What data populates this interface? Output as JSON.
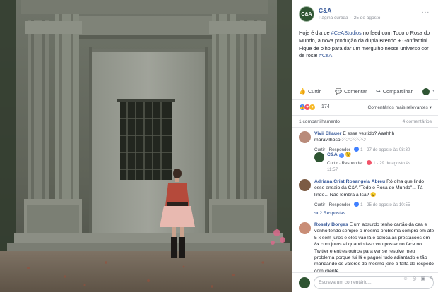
{
  "post": {
    "page_name": "C&A",
    "avatar_text": "C&A",
    "subtitle_type": "Página curtida",
    "date": "25 de agosto",
    "more_glyph": "···",
    "caption_before": "Hoje é dia de ",
    "caption_tag1": "#CeAStudios",
    "caption_middle": " no feed com Todo o Rosa do Mundo, a nova produção da dupla Brendo + Gonfiantini. Fique de olho para dar um mergulho nesse universo cor de rosa! ",
    "caption_tag2": "#CeA"
  },
  "actions": {
    "like": "Curtir",
    "comment": "Comentar",
    "share": "Compartilhar",
    "like_icon": "thumbs-up-icon",
    "comment_icon": "speech-bubble-icon",
    "share_icon": "share-arrow-icon"
  },
  "reactions": {
    "count": "174",
    "relevance": "Comentários mais relevantes ▾",
    "types": [
      "like",
      "love",
      "wow"
    ]
  },
  "shares": {
    "shares_text": "1 compartilhamento",
    "comments_text": "4 comentários"
  },
  "comments": [
    {
      "name": "Vivii Ellauer",
      "text": " E esse vestido? Aaahhh maravilhoso♡♡♡♡♡♡",
      "meta_actions": "Curtir · Responder ·",
      "meta_count": " 1",
      "meta_date": " · 27 de agosto às 08:30"
    },
    {
      "name": "C&A",
      "text": " ",
      "meta_actions": "Curtir · Responder ·",
      "meta_count": " 1",
      "meta_date": " · 29 de agosto às",
      "meta_time": "11:57"
    },
    {
      "name": "Adriana Crist Rosangela Abreu",
      "text": " Rô olha que lindo esse ensaio da C&A \"Todo o Rosa do Mundo\"... Tá lindo... Não lembra a Isa? 😉",
      "meta_actions": "Curtir · Responder ·",
      "meta_count": " 1",
      "meta_date": " · 25 de agosto às 10:55",
      "replies": "↪ 2 Respostas"
    },
    {
      "name": "Rosely Borges",
      "text": " E um absurdo tenho cartão da cea e venho tendo sempre o mesmo problema compro em ate 5 x sem juros e eles vão lá e coloca as prestações em 8x com juros aí quando isso vou postar no face no Twitter e entres outros para ver se resolve meu problema porque fui lá e paguei tudo adiantado e tão mandando os valores do mesmo jeito a falta de respeito com cliente"
    }
  ],
  "composer": {
    "placeholder": "Escreva um comentário...",
    "icons": "☺ ◎ ▣ ✎"
  },
  "colors": {
    "link": "#365899",
    "text": "#1d2129",
    "muted": "#90949c",
    "brand": "#2f5533"
  }
}
